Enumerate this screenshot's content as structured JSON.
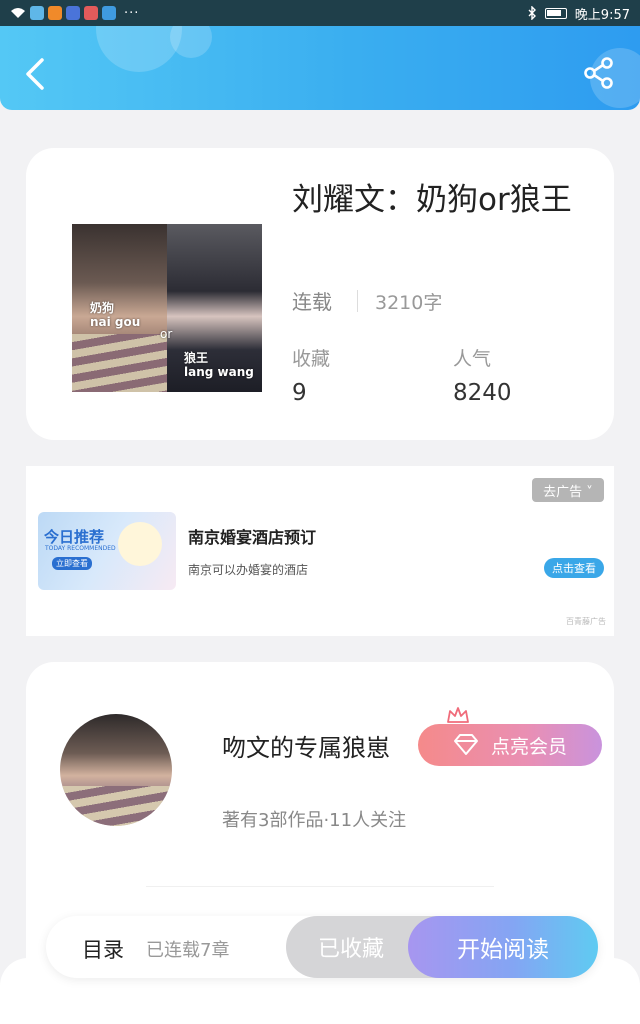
{
  "status_bar": {
    "time": "晚上9:57",
    "more": "···"
  },
  "book": {
    "title": "刘耀文：奶狗or狼王",
    "status": "连载",
    "word_count": "3210字",
    "favorites_label": "收藏",
    "favorites_value": "9",
    "popularity_label": "人气",
    "popularity_value": "8240",
    "cover_text": {
      "left_cn": "奶狗",
      "left_en": "nai gou",
      "or": "or",
      "right_cn": "狼王",
      "right_en": "lang wang"
    }
  },
  "ad": {
    "close_label": "去广告 ˅",
    "image_title": "今日推荐",
    "image_subtitle": "TODAY RECOMMENDED",
    "image_button": "立即查看",
    "title": "南京婚宴酒店预订",
    "description": "南京可以办婚宴的酒店",
    "cta": "点击查看",
    "source": "百青藤广告"
  },
  "author": {
    "name": "吻文的专属狼崽",
    "vip_label": "点亮会员",
    "meta": "著有3部作品·11人关注"
  },
  "bottom": {
    "toc_label": "目录",
    "chapters": "已连载7章",
    "favorite_label": "已收藏",
    "read_label": "开始阅读"
  },
  "colors": {
    "header_start": "#54c8f5",
    "header_end": "#2e9cf0",
    "read_start": "#a796f0",
    "read_end": "#5fcbf2",
    "vip_start": "#f58a8a",
    "vip_end": "#c993dd"
  }
}
